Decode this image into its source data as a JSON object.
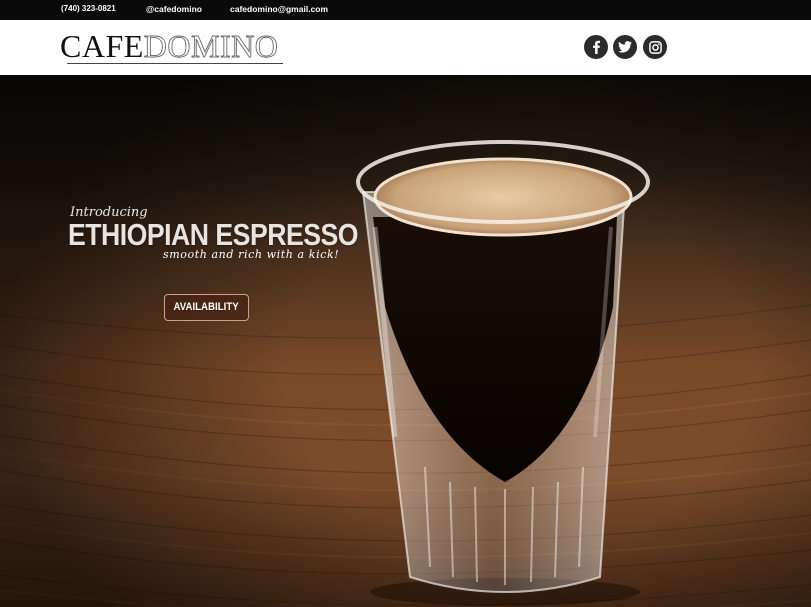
{
  "topbar": {
    "phone": "(740) 323-0821",
    "handle": "@cafedomino",
    "email": "cafedomino@gmail.com"
  },
  "header": {
    "logo_part1": "CAFE",
    "logo_part2": "DOMINO",
    "social": [
      {
        "name": "facebook",
        "icon": "facebook-icon"
      },
      {
        "name": "twitter",
        "icon": "twitter-icon"
      },
      {
        "name": "instagram",
        "icon": "instagram-icon"
      }
    ]
  },
  "hero": {
    "intro": "Introducing",
    "headline": "ETHIOPIAN ESPRESSO",
    "tagline": "smooth and rich with a kick!",
    "button_label": "AVAILABILITY"
  },
  "colors": {
    "topbar_bg": "#0a0a0a",
    "header_bg": "#ffffff",
    "button_bg": "#46201299",
    "social_bg": "#2b2b2b"
  }
}
